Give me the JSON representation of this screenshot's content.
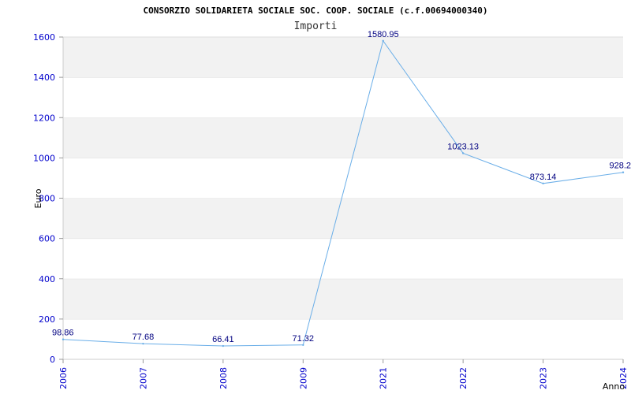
{
  "chart_data": {
    "type": "line",
    "title": "CONSORZIO SOLIDARIETA SOCIALE SOC. COOP. SOCIALE (c.f.00694000340)",
    "subtitle": "Importi",
    "xlabel": "Anno",
    "ylabel": "Euro",
    "categories": [
      "2006",
      "2007",
      "2008",
      "2009",
      "2021",
      "2022",
      "2023",
      "2024"
    ],
    "series": [
      {
        "values": [
          98.86,
          77.68,
          66.41,
          71.32,
          1580.95,
          1023.13,
          873.14,
          928.2
        ],
        "labels": [
          "98.86",
          "77.68",
          "66.41",
          "71.32",
          "1580.95",
          "1023.13",
          "873.14",
          "928.2"
        ],
        "color": "#6aaee8"
      }
    ],
    "ylim": [
      0,
      1600
    ],
    "yticks": [
      "0",
      "200",
      "400",
      "600",
      "800",
      "1000",
      "1200",
      "1400",
      "1600"
    ],
    "grid": true,
    "band_colors": [
      "#f2f2f2",
      "#ffffff"
    ],
    "tick_color": "#0000cc",
    "label_color": "#000080"
  }
}
